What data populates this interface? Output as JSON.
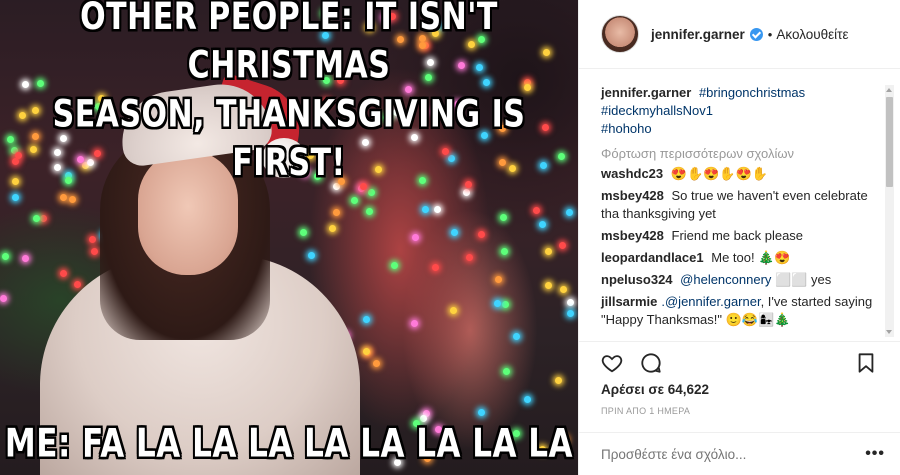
{
  "post": {
    "meme_top_line1": "OTHER PEOPLE: IT ISN'T CHRISTMAS",
    "meme_top_line2": "SEASON, THANKSGIVING IS FIRST!",
    "meme_bottom": "ME: FA LA LA LA LA LA LA LA LA"
  },
  "header": {
    "username": "jennifer.garner",
    "separator": "•",
    "follow_label": "Ακολουθείτε"
  },
  "caption": {
    "username": "jennifer.garner",
    "tag1": "#bringonchristmas",
    "tag2": "#ideckmyhallsNov1",
    "tag3": "#hohoho"
  },
  "load_more": "Φόρτωση περισσότερων σχολίων",
  "comments": [
    {
      "user": "washdc23",
      "text": "😍✋😍✋😍✋"
    },
    {
      "user": "msbey428",
      "text": "So true we haven't even celebrate tha thanksgiving yet"
    },
    {
      "user": "msbey428",
      "text": "Friend me back please"
    },
    {
      "user": "leopardandlace1",
      "text": "Me too! 🎄😍"
    },
    {
      "user": "npeluso324",
      "mention": "@helenconnery",
      "text": "⬜⬜ yes"
    },
    {
      "user": "jillsarmie",
      "mention": ".@jennifer.garner",
      "text": ", I've started saying \"Happy Thanksmas!\" 🙂😂👩‍👧🎄"
    }
  ],
  "likes": "Αρέσει σε 64,622",
  "time": "ΠΡΙΝ ΑΠΟ 1 ΗΜΕΡΑ",
  "add_comment_placeholder": "Προσθέστε ένα σχόλιο...",
  "more_label": "•••",
  "icons": [
    "heart-icon",
    "comment-icon",
    "bookmark-icon",
    "verified-badge-icon"
  ],
  "colors": {
    "link": "#003569",
    "verified": "#3897f0",
    "muted": "#999999"
  }
}
